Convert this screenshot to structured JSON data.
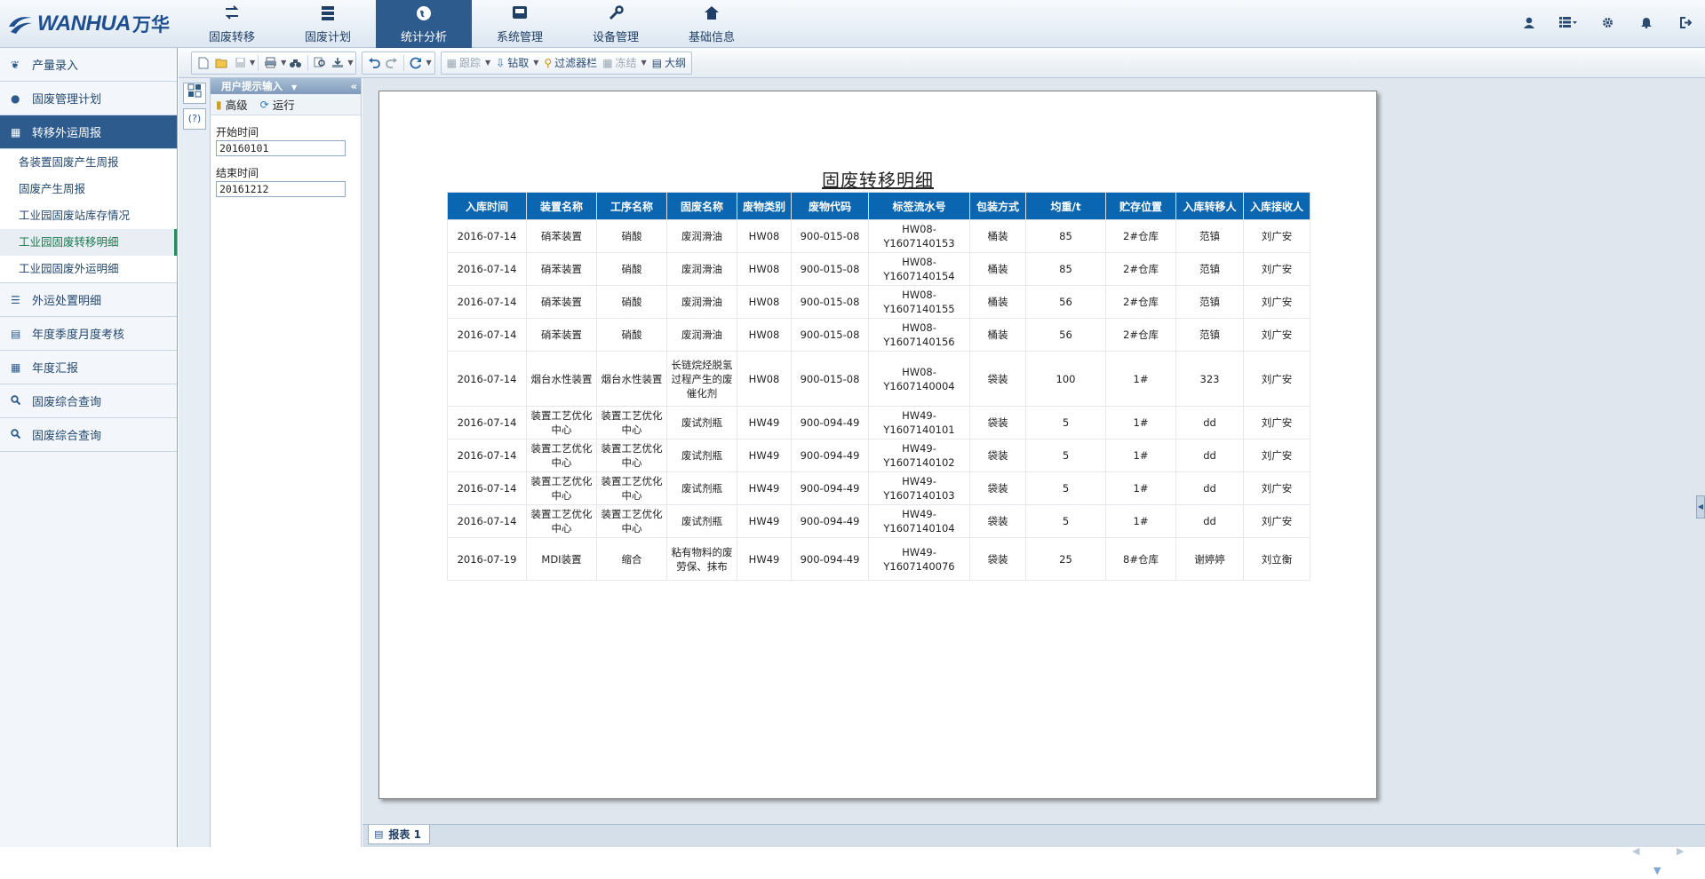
{
  "header": {
    "logo_text": "WANHUA",
    "logo_cn": "万华",
    "nav": [
      {
        "label": "固废转移",
        "icon": "transfer-arrows-icon"
      },
      {
        "label": "固废计划",
        "icon": "database-icon"
      },
      {
        "label": "统计分析",
        "icon": "globe-icon"
      },
      {
        "label": "系统管理",
        "icon": "inbox-icon"
      },
      {
        "label": "设备管理",
        "icon": "wrench-icon"
      },
      {
        "label": "基础信息",
        "icon": "home-icon"
      }
    ],
    "active_nav": "统计分析",
    "right_icons": [
      "user-icon",
      "list-menu-icon",
      "gear-icon",
      "bell-icon",
      "logout-icon"
    ]
  },
  "sidebar": {
    "items": [
      {
        "label": "产量录入",
        "icon": "leaf-icon"
      },
      {
        "label": "固废管理计划",
        "icon": "drop-icon"
      },
      {
        "label": "转移外运周报",
        "icon": "calendar-icon",
        "active": true
      },
      {
        "label": "外运处置明细",
        "icon": "list-icon"
      },
      {
        "label": "年度季度月度考核",
        "icon": "document-icon"
      },
      {
        "label": "年度汇报",
        "icon": "calendar-icon"
      },
      {
        "label": "固废综合查询",
        "icon": "search-icon"
      },
      {
        "label": "固废综合查询",
        "icon": "search-icon"
      }
    ],
    "submenu": [
      {
        "label": "各装置固废产生周报"
      },
      {
        "label": "固废产生周报"
      },
      {
        "label": "工业园固废站库存情况"
      },
      {
        "label": "工业园固废转移明细",
        "selected": true
      },
      {
        "label": "工业园固废外运明细"
      }
    ]
  },
  "toolbar": {
    "trace_label": "跟踪",
    "drill_label": "钻取",
    "filter_label": "过滤器栏",
    "freeze_label": "冻结",
    "outline_label": "大纲"
  },
  "param_panel": {
    "title": "用户提示输入",
    "advanced_label": "高级",
    "run_label": "运行",
    "start_label": "开始时间",
    "start_value": "20160101",
    "end_label": "结束时间",
    "end_value": "20161212"
  },
  "report": {
    "title": "固废转移明细",
    "columns": [
      "入库时间",
      "装置名称",
      "工序名称",
      "固废名称",
      "废物类别",
      "废物代码",
      "标签流水号",
      "包装方式",
      "均重/t",
      "贮存位置",
      "入库转移人",
      "入库接收人"
    ],
    "rows": [
      [
        "2016-07-14",
        "硝苯装置",
        "硝酸",
        "废润滑油",
        "HW08",
        "900-015-08",
        "HW08-Y1607140153",
        "桶装",
        "85",
        "2#仓库",
        "范镇",
        "刘广安"
      ],
      [
        "2016-07-14",
        "硝苯装置",
        "硝酸",
        "废润滑油",
        "HW08",
        "900-015-08",
        "HW08-Y1607140154",
        "桶装",
        "85",
        "2#仓库",
        "范镇",
        "刘广安"
      ],
      [
        "2016-07-14",
        "硝苯装置",
        "硝酸",
        "废润滑油",
        "HW08",
        "900-015-08",
        "HW08-Y1607140155",
        "桶装",
        "56",
        "2#仓库",
        "范镇",
        "刘广安"
      ],
      [
        "2016-07-14",
        "硝苯装置",
        "硝酸",
        "废润滑油",
        "HW08",
        "900-015-08",
        "HW08-Y1607140156",
        "桶装",
        "56",
        "2#仓库",
        "范镇",
        "刘广安"
      ],
      [
        "2016-07-14",
        "烟台水性装置",
        "烟台水性装置",
        "长链烷烃脱氢过程产生的废催化剂",
        "HW08",
        "900-015-08",
        "HW08-Y1607140004",
        "袋装",
        "100",
        "1#",
        "323",
        "刘广安"
      ],
      [
        "2016-07-14",
        "装置工艺优化中心",
        "装置工艺优化中心",
        "废试剂瓶",
        "HW49",
        "900-094-49",
        "HW49-Y1607140101",
        "袋装",
        "5",
        "1#",
        "dd",
        "刘广安"
      ],
      [
        "2016-07-14",
        "装置工艺优化中心",
        "装置工艺优化中心",
        "废试剂瓶",
        "HW49",
        "900-094-49",
        "HW49-Y1607140102",
        "袋装",
        "5",
        "1#",
        "dd",
        "刘广安"
      ],
      [
        "2016-07-14",
        "装置工艺优化中心",
        "装置工艺优化中心",
        "废试剂瓶",
        "HW49",
        "900-094-49",
        "HW49-Y1607140103",
        "袋装",
        "5",
        "1#",
        "dd",
        "刘广安"
      ],
      [
        "2016-07-14",
        "装置工艺优化中心",
        "装置工艺优化中心",
        "废试剂瓶",
        "HW49",
        "900-094-49",
        "HW49-Y1607140104",
        "袋装",
        "5",
        "1#",
        "dd",
        "刘广安"
      ],
      [
        "2016-07-19",
        "MDI装置",
        "缩合",
        "粘有物料的废劳保、抹布",
        "HW49",
        "900-094-49",
        "HW49-Y1607140076",
        "袋装",
        "25",
        "8#仓库",
        "谢婷婷",
        "刘立衡"
      ]
    ]
  },
  "footer": {
    "sheet_tab": "报表 1"
  }
}
